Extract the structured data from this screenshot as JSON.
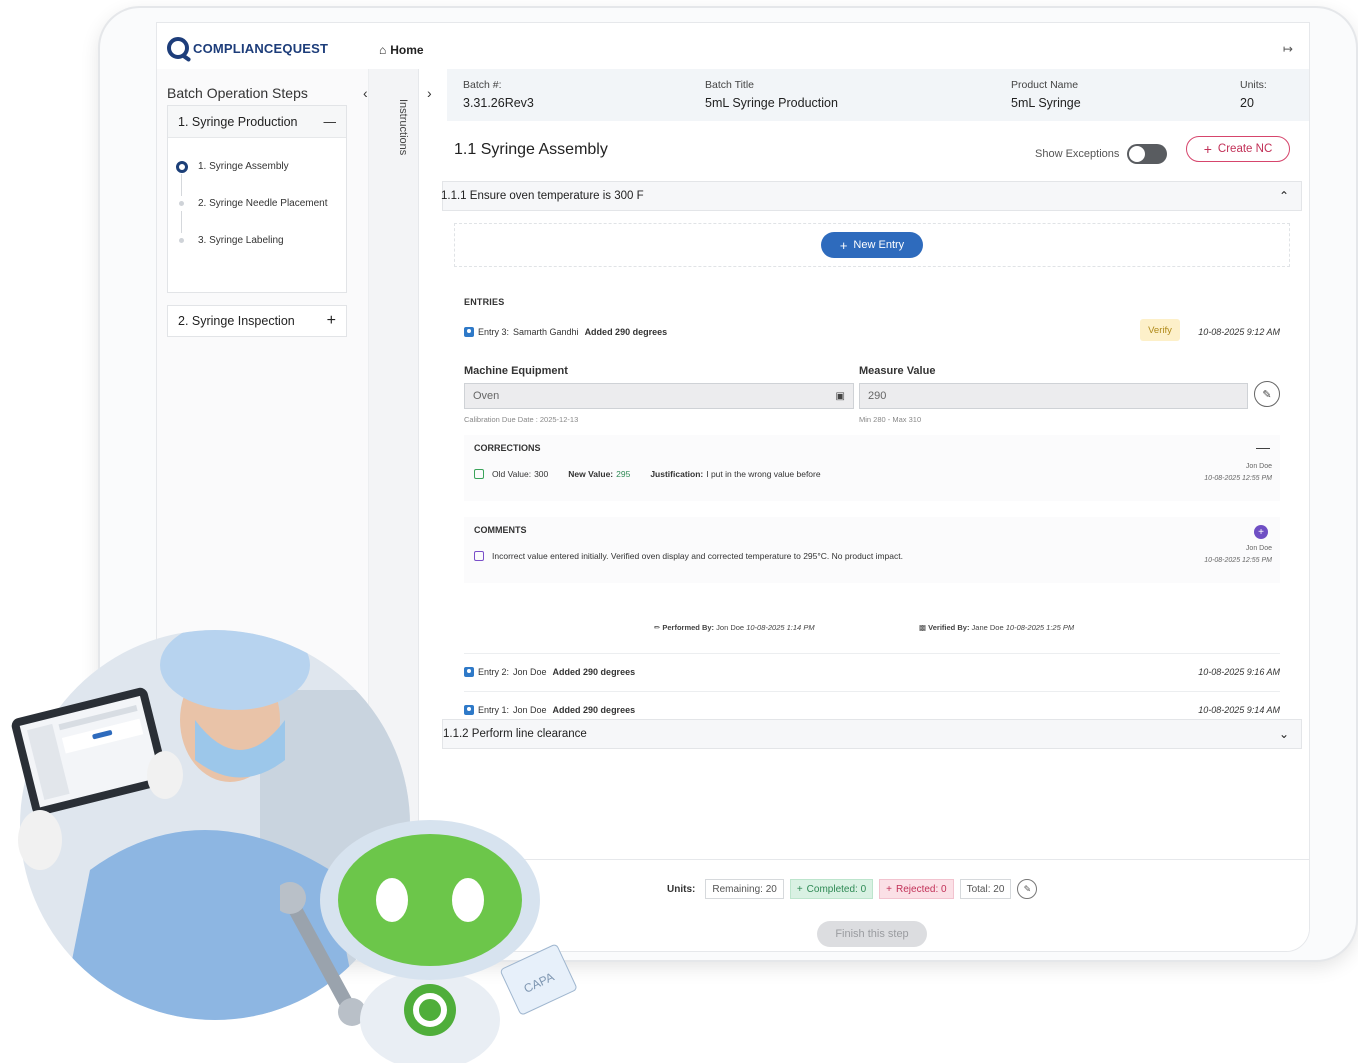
{
  "app": {
    "logo_text": "COMPLIANCEQUEST",
    "home_label": "Home",
    "brand_color": "#1d3d7a"
  },
  "left": {
    "title": "Batch Operation Steps",
    "steps": [
      {
        "label": "1. Syringe Production",
        "expanded": true,
        "substeps": [
          {
            "label": "1. Syringe Assembly",
            "active": true
          },
          {
            "label": "2. Syringe Needle Placement",
            "active": false
          },
          {
            "label": "3. Syringe Labeling",
            "active": false
          }
        ]
      },
      {
        "label": "2. Syringe Inspection",
        "expanded": false
      }
    ]
  },
  "instructions_label": "Instructions",
  "batch": {
    "batch_no_label": "Batch #:",
    "batch_no": "3.31.26Rev3",
    "title_label": "Batch Title",
    "title": "5mL Syringe Production",
    "product_label": "Product Name",
    "product": "5mL Syringe",
    "units_label": "Units:",
    "units": "20"
  },
  "step": {
    "title": "1.1 Syringe Assembly",
    "show_exceptions_label": "Show Exceptions",
    "show_exceptions_on": false,
    "create_nc_label": "Create NC"
  },
  "tasks": [
    {
      "title": "1.1.1 Ensure oven temperature is 300 F",
      "expanded": true,
      "new_entry_label": "New Entry",
      "entries_label": "ENTRIES",
      "entries": [
        {
          "id": "Entry 3:",
          "who": "Samarth Gandhi",
          "what": "Added 290 degrees",
          "badge": "Verify",
          "time": "10-08-2025 9:12 AM",
          "detail": {
            "machine_label": "Machine Equipment",
            "machine_value": "Oven",
            "machine_hint": "Calibration Due Date : 2025-12-13",
            "measure_label": "Measure Value",
            "measure_value": "290",
            "measure_hint": "Min 280 - Max 310",
            "corrections_label": "CORRECTIONS",
            "correction": {
              "old_label": "Old Value:",
              "old_value": "300",
              "new_label": "New Value:",
              "new_value": "295",
              "justification_label": "Justification:",
              "justification": "I put in the wrong value before",
              "who": "Jon Doe",
              "time": "10-08-2025 12:55 PM"
            },
            "comments_label": "COMMENTS",
            "comment": {
              "text": "Incorrect value entered initially. Verified oven display and corrected temperature to 295°C. No product impact.",
              "who": "Jon Doe",
              "time": "10-08-2025 12:55 PM"
            },
            "performed_label": "Performed By:",
            "performed_by": "Jon Doe",
            "performed_time": "10-08-2025 1:14 PM",
            "verified_label": "Verified By:",
            "verified_by": "Jane Doe",
            "verified_time": "10-08-2025 1:25 PM"
          }
        },
        {
          "id": "Entry 2:",
          "who": "Jon Doe",
          "what": "Added 290 degrees",
          "time": "10-08-2025 9:16 AM"
        },
        {
          "id": "Entry 1:",
          "who": "Jon Doe",
          "what": "Added 290 degrees",
          "time": "10-08-2025 9:14 AM"
        }
      ]
    },
    {
      "title": "1.1.2 Perform line clearance",
      "expanded": false
    }
  ],
  "footer": {
    "units_label": "Units:",
    "remaining": "Remaining: 20",
    "completed": "Completed: 0",
    "rejected": "Rejected: 0",
    "total": "Total: 20",
    "finish_label": "Finish this step"
  },
  "illustration": {
    "badge_text": "CAPA"
  },
  "colors": {
    "accent_blue": "#2e6bbd",
    "nc_pink": "#c23158",
    "verify_bg": "#fdf0c9",
    "completed_bg": "#d9f1e3",
    "rejected_bg": "#fbe0e6"
  }
}
